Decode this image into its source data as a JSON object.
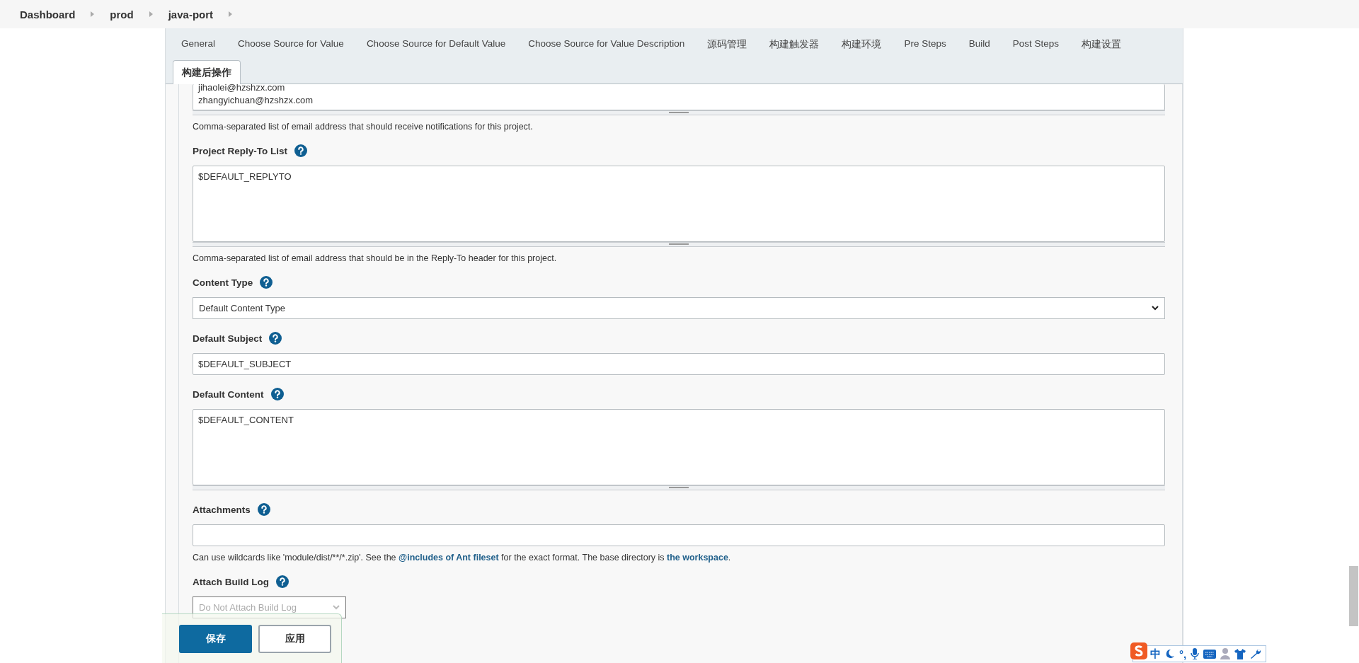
{
  "breadcrumbs": [
    "Dashboard",
    "prod",
    "java-port"
  ],
  "tabs": [
    {
      "label": "General",
      "selected": false
    },
    {
      "label": "Choose Source for Value",
      "selected": false
    },
    {
      "label": "Choose Source for Default Value",
      "selected": false
    },
    {
      "label": "Choose Source for Value Description",
      "selected": false
    },
    {
      "label": "源码管理",
      "selected": false
    },
    {
      "label": "构建触发器",
      "selected": false
    },
    {
      "label": "构建环境",
      "selected": false
    },
    {
      "label": "Pre Steps",
      "selected": false
    },
    {
      "label": "Build",
      "selected": false
    },
    {
      "label": "Post Steps",
      "selected": false
    },
    {
      "label": "构建设置",
      "selected": false
    },
    {
      "label": "构建后操作",
      "selected": true
    }
  ],
  "fields": [
    {
      "kind": "scrolledtextarea",
      "lines": [
        "jihaolei@hzshzx.com",
        "zhangyichuan@hzshzx.com"
      ],
      "help": [
        {
          "text": "Comma-separated list of email address that should receive notifications for this project.",
          "link": false
        }
      ]
    },
    {
      "kind": "textarea",
      "label": "Project Reply-To List",
      "lines": [
        "$DEFAULT_REPLYTO"
      ],
      "help": [
        {
          "text": "Comma-separated list of email address that should be in the Reply-To header for this project.",
          "link": false
        }
      ]
    },
    {
      "kind": "select",
      "label": "Content Type",
      "value": "Default Content Type"
    },
    {
      "kind": "input",
      "label": "Default Subject",
      "value": "$DEFAULT_SUBJECT"
    },
    {
      "kind": "textarea",
      "label": "Default Content",
      "lines": [
        "$DEFAULT_CONTENT"
      ]
    },
    {
      "kind": "input",
      "label": "Attachments",
      "help": [
        {
          "text": "Can use wildcards like 'module/dist/**/*.zip'. See the ",
          "link": false
        },
        {
          "text": "@includes of Ant fileset",
          "link": true
        },
        {
          "text": " for the exact format. The base directory is ",
          "link": false
        },
        {
          "text": "the workspace",
          "link": true
        },
        {
          "text": ".",
          "link": false
        }
      ]
    },
    {
      "kind": "smallselect",
      "label": "Attach Build Log",
      "value": "Do Not Attach Build Log"
    }
  ],
  "buttons": [
    {
      "label": "保存",
      "primary": true
    },
    {
      "label": "应用",
      "primary": false
    }
  ],
  "ime_toolbar": {
    "language": "中",
    "punctuation": "°,"
  }
}
